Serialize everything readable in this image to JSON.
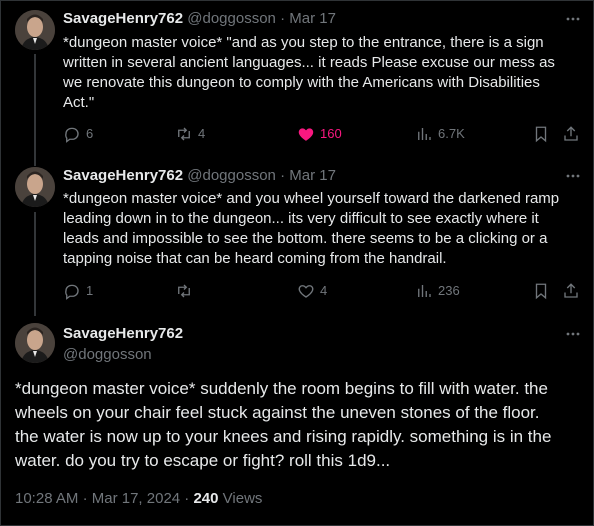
{
  "tweets": [
    {
      "name": "SavageHenry762",
      "handle": "@doggosson",
      "separator": "·",
      "date": "Mar 17",
      "text": "*dungeon master voice* \"and as you step to the entrance, there is a sign\nwritten in several ancient languages... it reads Please excuse our mess as\nwe renovate this dungeon to comply with the Americans with Disabilities\nAct.\"",
      "replies": "6",
      "retweets": "4",
      "likes": "160",
      "liked": true,
      "views": "6.7K"
    },
    {
      "name": "SavageHenry762",
      "handle": "@doggosson",
      "separator": "·",
      "date": "Mar 17",
      "text": "*dungeon master voice* and you wheel yourself toward the darkened ramp\nleading down in to the dungeon... its very difficult to see exactly where it\nleads and impossible to see the bottom. there seems to be a clicking or a\ntapping noise that can be heard coming from the handrail.",
      "replies": "1",
      "retweets": "",
      "likes": "4",
      "liked": false,
      "views": "236"
    }
  ],
  "focus": {
    "name": "SavageHenry762",
    "handle": "@doggosson",
    "text": "*dungeon master voice* suddenly the room begins to fill with water. the\nwheels on your chair feel stuck against the uneven stones of the floor.\nthe water is now up to your knees and rising rapidly. something is in the\nwater. do you try to escape or fight?  roll this 1d9...",
    "time": "10:28 AM",
    "separator": "·",
    "date": "Mar 17, 2024",
    "separator2": "·",
    "views_count": "240",
    "views_label": "Views"
  },
  "colors": {
    "background": "#000000",
    "text": "#e7e9ea",
    "muted": "#71767b",
    "like": "#f91880",
    "thread_line": "#333639"
  },
  "icons": [
    "more-icon",
    "reply-icon",
    "retweet-icon",
    "like-icon",
    "views-icon",
    "bookmark-icon",
    "share-icon"
  ]
}
